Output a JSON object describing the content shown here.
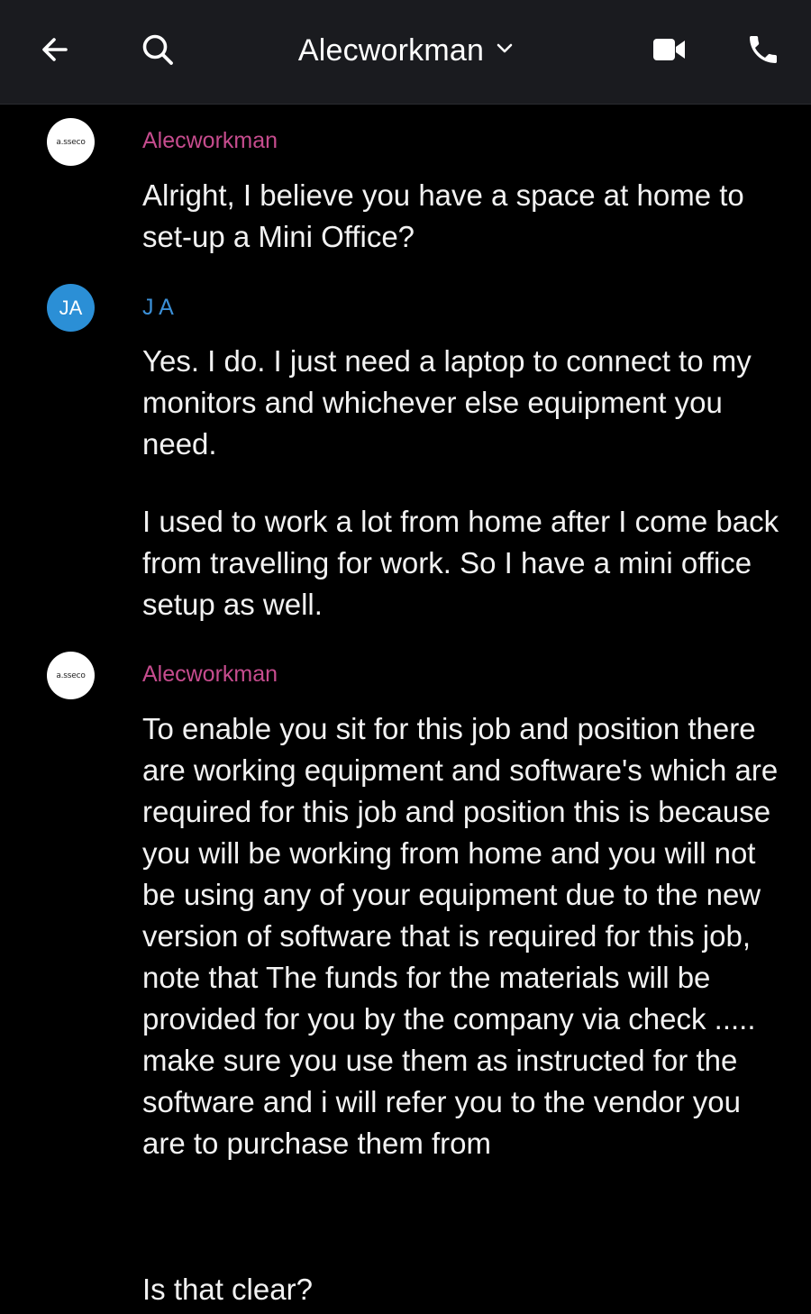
{
  "header": {
    "title": "Alecworkman",
    "back_icon": "arrow-left-icon",
    "search_icon": "search-icon",
    "dropdown_icon": "chevron-down-icon",
    "video_icon": "video-camera-icon",
    "call_icon": "phone-icon"
  },
  "colors": {
    "header_bg": "#1a1b1f",
    "page_bg": "#000000",
    "sender_pink": "#c64c8e",
    "sender_blue": "#3b8fd6",
    "avatar_blue": "#2b8fd6"
  },
  "messages": [
    {
      "sender": "Alecworkman",
      "avatar_text": "a.sseco",
      "lines": [
        "Alright, I believe you have a space at home to set-up a Mini Office?"
      ]
    },
    {
      "sender": "J A",
      "avatar_text": "JA",
      "lines": [
        "Yes. I do. I just need a laptop to connect to my monitors and whichever else equipment you need.",
        "I used to work a lot from home after I come back from travelling for work. So I have a mini office setup as well."
      ]
    },
    {
      "sender": "Alecworkman",
      "avatar_text": "a.sseco",
      "lines": [
        "To enable you sit for this job and position there are working equipment and software's which are required for this job and position this is because you will be working from home and you will not be using any of your equipment due to the new version of software that is required for this job, note that The funds for the materials will be provided for you by the company via check ..... make sure you use them as instructed for the software and i will refer you to the vendor you are to purchase them from",
        "Is that clear?"
      ]
    }
  ]
}
